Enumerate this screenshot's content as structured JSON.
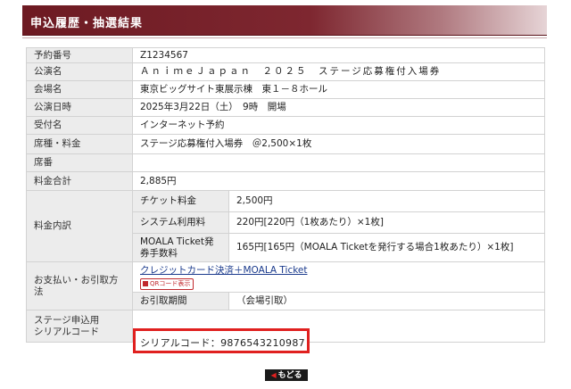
{
  "header": {
    "title": "申込履歴・抽選結果"
  },
  "rows": {
    "reception_no": {
      "label": "予約番号",
      "value": "Z1234567"
    },
    "performance": {
      "label": "公演名",
      "value": "ＡｎｉｍｅＪａｐａｎ　２０２５　ステージ応募権付入場券"
    },
    "venue": {
      "label": "会場名",
      "value": "東京ビッグサイト東展示棟　東１－８ホール"
    },
    "datetime": {
      "label": "公演日時",
      "value": "2025年3月22日（土）　9時　開場"
    },
    "reception": {
      "label": "受付名",
      "value": "インターネット予約"
    },
    "seat_fee": {
      "label": "席種・料金",
      "value": "ステージ応募権付入場券　＠2,500×1枚"
    },
    "seat_no": {
      "label": "席番",
      "value": ""
    },
    "total": {
      "label": "料金合計",
      "value": "2,885円"
    },
    "breakdown": {
      "label": "料金内訳",
      "items": [
        {
          "label": "チケット料金",
          "value": "2,500円"
        },
        {
          "label": "システム利用料",
          "value": "220円[220円（1枚あたり）×1枚]"
        },
        {
          "label": "MOALA Ticket発券手数料",
          "value": "165円[165円（MOALA Ticketを発行する場合1枚あたり）×1枚]"
        }
      ]
    },
    "payment": {
      "label": "お支払い・お引取方法",
      "method": "クレジットカード決済＋MOALA Ticket",
      "qr_badge": "QRコード表示",
      "pickup_label": "お引取期間",
      "pickup_value": "（会場引取）"
    },
    "serial": {
      "label_line1": "ステージ申込用",
      "label_line2": "シリアルコード",
      "value": "シリアルコード：9876543210987"
    }
  },
  "footer": {
    "back_label": "もどる"
  },
  "colors": {
    "header": "#7e2730",
    "highlight": "#e0201f",
    "label_bg": "#ececec"
  }
}
